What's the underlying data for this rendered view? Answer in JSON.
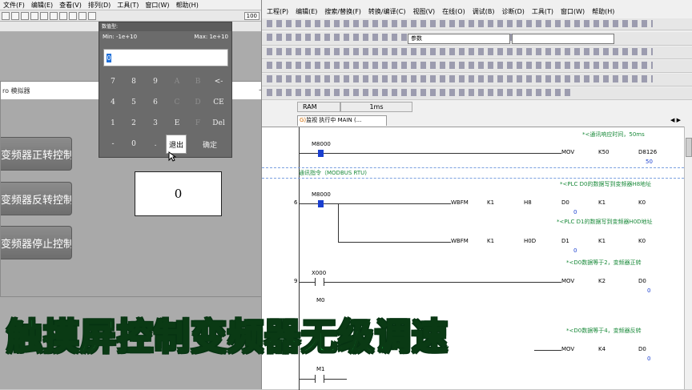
{
  "left_app": {
    "menu": [
      "文件(F)",
      "编辑(E)",
      "查看(V)",
      "排列(D)",
      "工具(T)",
      "窗口(W)",
      "帮助(H)"
    ],
    "zoom_value": "100"
  },
  "simulator": {
    "title": "ro 模拟器",
    "buttons": [
      "变频器正转控制",
      "变频器反转控制",
      "变频器停止控制"
    ],
    "frequency_value": "0"
  },
  "keypad": {
    "title": "数值型:",
    "min_label": "Min: -1e+10",
    "max_label": "Max: 1e+10",
    "input_value": "0",
    "rows": [
      [
        "7",
        "8",
        "9",
        "A",
        "B",
        "<-"
      ],
      [
        "4",
        "5",
        "6",
        "C",
        "D",
        "CE"
      ],
      [
        "1",
        "2",
        "3",
        "E",
        "F",
        "Del"
      ],
      [
        "-",
        "0",
        ".",
        "退出",
        "确定"
      ]
    ]
  },
  "right_app": {
    "menu": [
      "工程(P)",
      "编辑(E)",
      "搜索/替换(F)",
      "转换/编译(C)",
      "视图(V)",
      "在线(O)",
      "调试(B)",
      "诊断(D)",
      "工具(T)",
      "窗口(W)",
      "帮助(H)"
    ],
    "param_select": "参数",
    "status_cells": [
      "RAM",
      "1ms"
    ],
    "tab_prefix": "G)",
    "tab_label": "监视 执行中 MAIN (...",
    "nav_arrows": "◀ ▶"
  },
  "ladder": {
    "rung1": {
      "comment": "*<通讯响应时间，50ms",
      "contact": "M8000",
      "instr": "MOV",
      "op1": "K50",
      "op2": "D8126",
      "value": "50"
    },
    "rung2_comment": "通讯指令（MODBUS RTU)",
    "rung2_header_comment": "*<PLC D0的数据写到变频器H8地址",
    "rung2": {
      "step": "6",
      "contact": "M8000",
      "instr": "WBFM",
      "op1": "K1",
      "op2": "H8",
      "op3": "D0",
      "op4": "K1",
      "op5": "K0",
      "value": "0"
    },
    "rung3_comment": "*<PLC D1的数据写到变频器H0D地址",
    "rung3": {
      "instr": "WBFM",
      "op1": "K1",
      "op2": "H0D",
      "op3": "D1",
      "op4": "K1",
      "op5": "K0",
      "value": "0"
    },
    "rung4_comment": "*<D0数据等于2，变频器正转",
    "rung4": {
      "step": "9",
      "contact": "X000",
      "contact2": "M0",
      "instr": "MOV",
      "op1": "K2",
      "op2": "D0",
      "value": "0"
    },
    "rung5_comment": "*<D0数据等于4，变频器反转",
    "rung5": {
      "contact": "M1",
      "instr": "MOV",
      "op1": "K4",
      "op2": "D0",
      "value": "0"
    }
  },
  "caption": "触摸屏控制变频器无级调速"
}
